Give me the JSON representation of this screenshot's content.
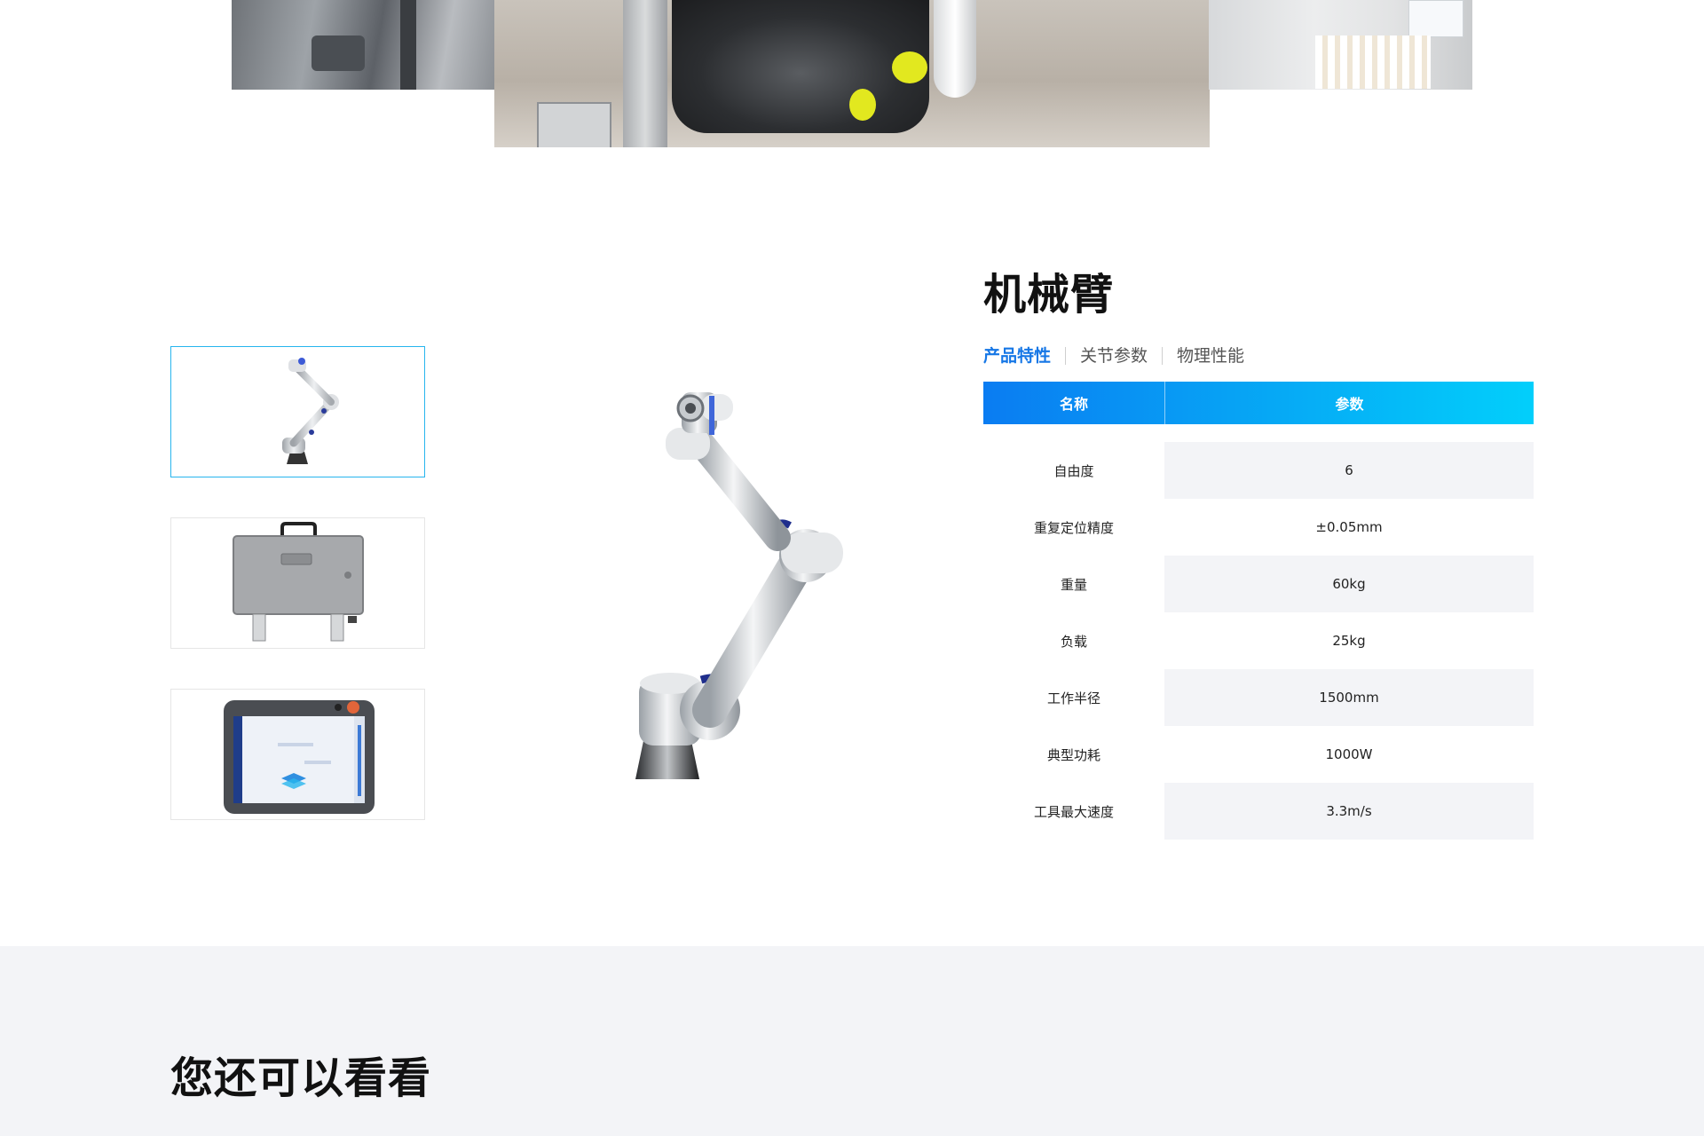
{
  "top_gallery": {
    "images": [
      {
        "name": "factory-robot-left"
      },
      {
        "name": "engine-assembly-center"
      },
      {
        "name": "lab-cups-right"
      }
    ]
  },
  "product": {
    "title": "机械臂",
    "tabs": [
      {
        "label": "产品特性",
        "active": true
      },
      {
        "label": "关节参数",
        "active": false
      },
      {
        "label": "物理性能",
        "active": false
      }
    ],
    "table": {
      "headers": [
        "名称",
        "参数"
      ],
      "rows": [
        {
          "name": "自由度",
          "value": "6"
        },
        {
          "name": "重复定位精度",
          "value": "±0.05mm"
        },
        {
          "name": "重量",
          "value": "60kg"
        },
        {
          "name": "负载",
          "value": "25kg"
        },
        {
          "name": "工作半径",
          "value": "1500mm"
        },
        {
          "name": "典型功耗",
          "value": "1000W"
        },
        {
          "name": "工具最大速度",
          "value": "3.3m/s"
        }
      ]
    },
    "thumbnails": [
      {
        "name": "robot-arm-thumbnail",
        "active": true
      },
      {
        "name": "control-box-thumbnail",
        "active": false
      },
      {
        "name": "teach-pendant-thumbnail",
        "active": false
      }
    ]
  },
  "more_section": {
    "title": "您还可以看看"
  },
  "colors": {
    "accent": "#1677e6",
    "header_gradient_start": "#0a7cf2",
    "header_gradient_end": "#02cffb",
    "row_shade": "#f3f4f7",
    "thumb_active_border": "#27b5ee"
  }
}
